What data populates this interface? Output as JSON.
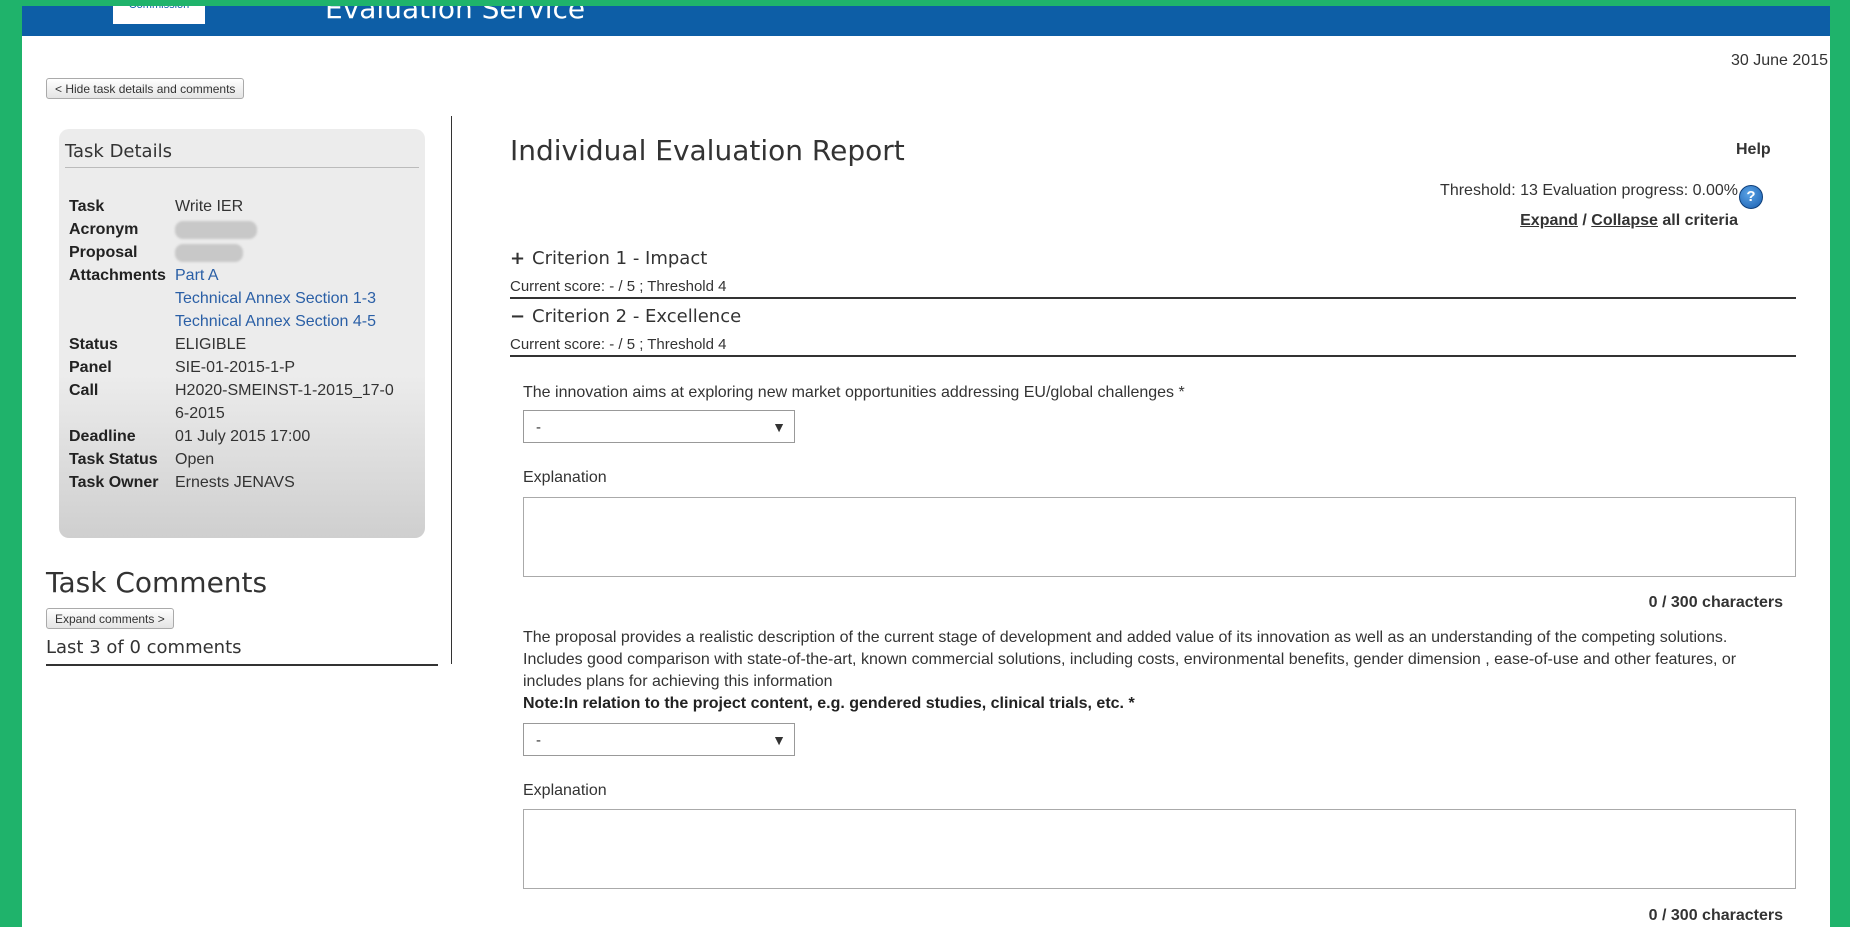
{
  "header": {
    "logo_text": "Commission",
    "service_title": "Evaluation Service"
  },
  "date": "30 June 2015",
  "hide_button": "< Hide task details and comments",
  "task_details": {
    "title": "Task Details",
    "labels": {
      "task": "Task",
      "acronym": "Acronym",
      "proposal": "Proposal",
      "attachments": "Attachments",
      "status": "Status",
      "panel": "Panel",
      "call": "Call",
      "deadline": "Deadline",
      "task_status": "Task Status",
      "task_owner": "Task Owner"
    },
    "values": {
      "task": "Write IER",
      "attachments": [
        "Part A",
        "Technical Annex Section 1-3",
        "Technical Annex Section 4-5"
      ],
      "status": "ELIGIBLE",
      "panel": "SIE-01-2015-1-P",
      "call": "H2020-SMEINST-1-2015_17-06-2015",
      "deadline": "01 July 2015 17:00",
      "task_status": "Open",
      "task_owner": "Ernests JENAVS"
    }
  },
  "comments": {
    "title": "Task Comments",
    "expand_button": "Expand comments >",
    "count_text": "Last 3 of 0 comments"
  },
  "report": {
    "title": "Individual Evaluation Report",
    "help": "Help",
    "threshold_text": "Threshold: 13 Evaluation progress: 0.00%",
    "help_icon": "?",
    "expand": "Expand",
    "separator": " / ",
    "collapse": "Collapse",
    "all_criteria": " all criteria",
    "criteria": [
      {
        "sign": "+",
        "title": "Criterion 1 - Impact",
        "score": "Current score: - / 5 ; Threshold 4"
      },
      {
        "sign": "−",
        "title": "Criterion 2 - Excellence",
        "score": "Current score: - / 5 ; Threshold 4"
      }
    ],
    "questions": [
      {
        "text": "The innovation aims at exploring new market opportunities addressing EU/global challenges *",
        "note": "",
        "select_value": "-",
        "explanation_label": "Explanation",
        "char_count": "0 / 300 characters"
      },
      {
        "text": "The proposal provides a realistic description of the current stage of development and added value of its innovation as well as an understanding of the competing solutions. Includes good comparison with state-of-the-art, known commercial solutions, including costs, environmental benefits, gender dimension , ease-of-use and other features, or includes plans for achieving this information",
        "note": "Note:In relation to the project content, e.g. gendered studies, clinical trials, etc. *",
        "select_value": "-",
        "explanation_label": "Explanation",
        "char_count": "0 / 300 characters"
      }
    ]
  },
  "icons": {
    "dropdown": "chevron-down-icon",
    "help": "question-circle-icon"
  },
  "colors": {
    "frame": "#1fb36b",
    "header": "#0d5ea6",
    "link": "#2a5fa6"
  }
}
